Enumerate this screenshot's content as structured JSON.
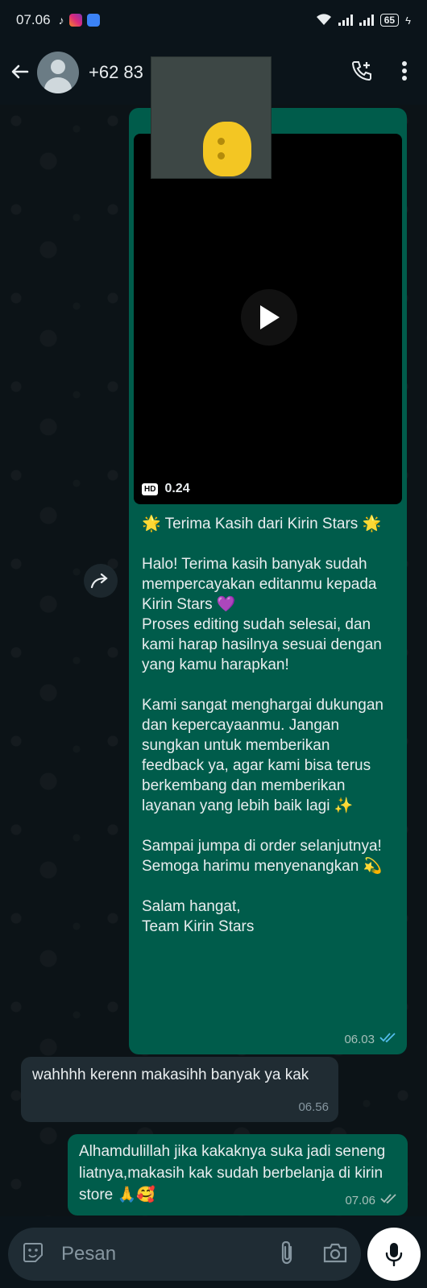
{
  "status_bar": {
    "time": "07.06",
    "battery": "65"
  },
  "header": {
    "contact_name": "+62 83",
    "icons": [
      "back-arrow-icon",
      "avatar",
      "add-call-icon",
      "more-options-icon"
    ]
  },
  "messages": [
    {
      "direction": "outgoing",
      "video": {
        "quality": "HD",
        "duration": "0.24"
      },
      "text": "🌟 Terima Kasih dari Kirin Stars 🌟\n\nHalo! Terima kasih banyak sudah mempercayakan editanmu kepada Kirin Stars 💜\nProses editing sudah selesai, dan kami harap hasilnya sesuai dengan yang kamu harapkan!\n\nKami sangat menghargai dukungan dan kepercayaanmu. Jangan sungkan untuk memberikan feedback ya, agar kami bisa terus berkembang dan memberikan layanan yang lebih baik lagi ✨\n\nSampai jumpa di order selanjutnya!\nSemoga harimu menyenangkan 💫\n\nSalam hangat,\nTeam Kirin Stars",
      "time": "06.03",
      "status": "read"
    },
    {
      "direction": "incoming",
      "text": "wahhhh kerenn makasihh banyak ya kak",
      "time": "06.56"
    },
    {
      "direction": "outgoing",
      "text": "Alhamdulillah jika kakaknya suka jadi seneng liatnya,makasih kak sudah berbelanja di kirin store 🙏🥰",
      "time": "07.06",
      "status": "delivered"
    }
  ],
  "input": {
    "placeholder": "Pesan"
  },
  "colors": {
    "outgoing_bubble": "#005c4b",
    "incoming_bubble": "#202c33",
    "read_tick": "#53bdeb"
  }
}
